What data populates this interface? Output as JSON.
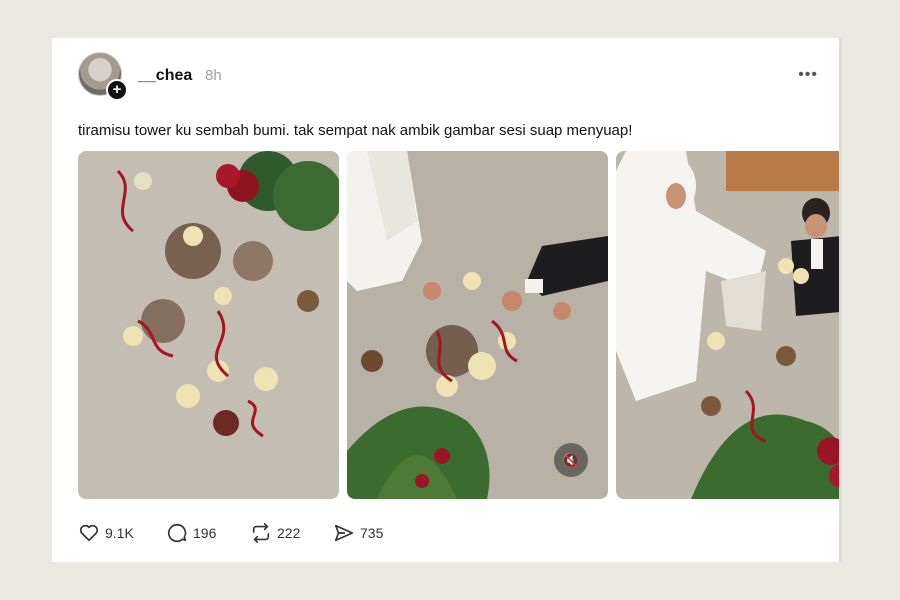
{
  "post": {
    "username": "__chea",
    "time": "8h",
    "more_label": "•••",
    "caption": "tiramisu tower ku sembah bumi. tak sempat nak ambik gambar sesi suap menyuap!",
    "photos": [
      {
        "description": "Dropped tiramisu cups scattered on concrete floor with red ribbons and roses"
      },
      {
        "description": "Bride and groom picking up tiramisu cups near flower arrangement"
      },
      {
        "description": "Bride and groom crouching on floor holding tiramisu cups"
      }
    ],
    "mute_icon": "speaker-muted-icon"
  },
  "actions": {
    "like_count": "9.1K",
    "reply_count": "196",
    "repost_count": "222",
    "share_count": "735"
  },
  "colors": {
    "background": "#ebe8e2",
    "card": "#ffffff",
    "muted_text": "#a0a0a0"
  }
}
